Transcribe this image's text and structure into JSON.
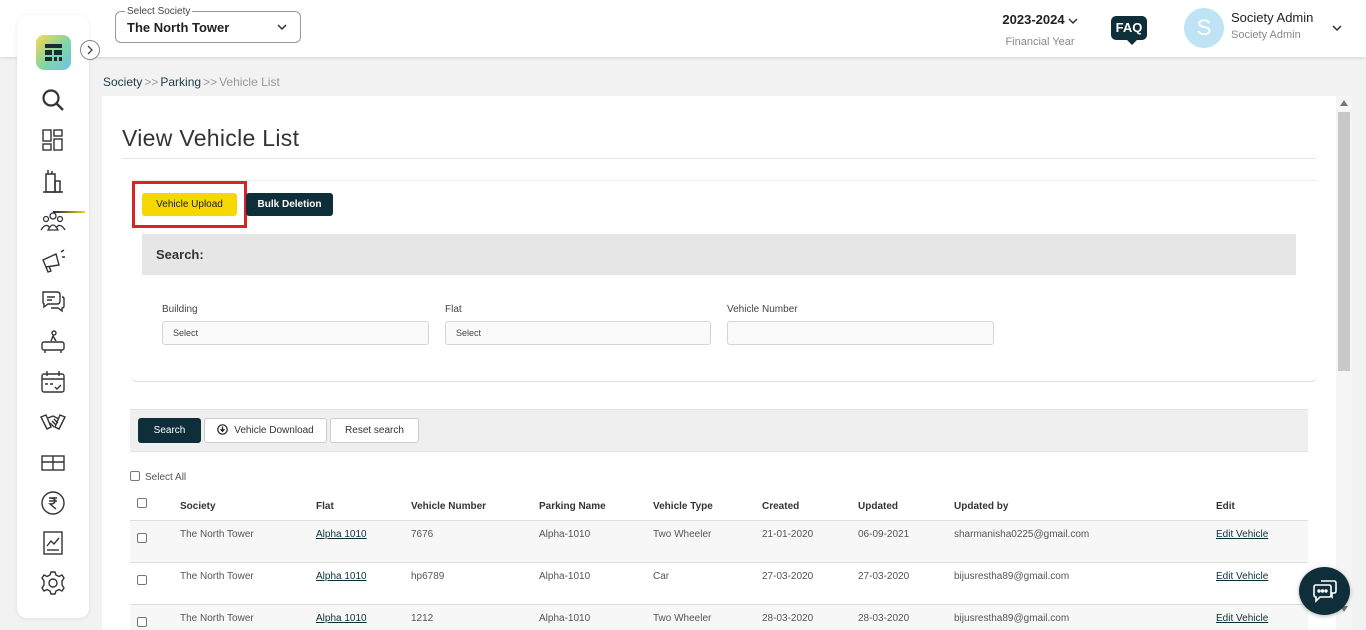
{
  "header": {
    "society_select": {
      "label": "Select Society",
      "value": "The North Tower"
    },
    "financial_year": {
      "value": "2023-2024",
      "label": "Financial Year"
    },
    "faq_label": "FAQ",
    "user": {
      "initial": "S",
      "name": "Society Admin",
      "role": "Society Admin"
    }
  },
  "sidebar": {
    "items": [
      {
        "icon": "search-icon"
      },
      {
        "icon": "dashboard-icon"
      },
      {
        "icon": "building-icon",
        "active": true
      },
      {
        "icon": "people-icon"
      },
      {
        "icon": "megaphone-icon"
      },
      {
        "icon": "chat-icon"
      },
      {
        "icon": "amenities-icon"
      },
      {
        "icon": "calendar-icon"
      },
      {
        "icon": "handshake-icon"
      },
      {
        "icon": "gift-icon"
      },
      {
        "icon": "rupee-icon"
      },
      {
        "icon": "report-icon"
      },
      {
        "icon": "settings-icon"
      }
    ]
  },
  "breadcrumb": {
    "items": [
      "Society",
      "Parking",
      "Vehicle List"
    ],
    "separator": ">>"
  },
  "page": {
    "title": "View Vehicle List",
    "buttons": {
      "upload": "Vehicle Upload",
      "bulk_delete": "Bulk Deletion"
    },
    "search": {
      "heading": "Search:",
      "building": {
        "label": "Building",
        "value": "Select"
      },
      "flat": {
        "label": "Flat",
        "value": "Select"
      },
      "vehicle_number": {
        "label": "Vehicle Number",
        "value": ""
      }
    },
    "actions": {
      "search": "Search",
      "download": "Vehicle Download",
      "reset": "Reset search"
    },
    "select_all": "Select All"
  },
  "table": {
    "columns": [
      "Society",
      "Flat",
      "Vehicle Number",
      "Parking Name",
      "Vehicle Type",
      "Created",
      "Updated",
      "Updated by",
      "Edit"
    ],
    "rows": [
      {
        "society": "The North Tower",
        "flat": "Alpha 1010",
        "vehicle_number": "7676",
        "parking_name": "Alpha-1010",
        "vehicle_type": "Two Wheeler",
        "created": "21-01-2020",
        "updated": "06-09-2021",
        "updated_by": "sharmanisha0225@gmail.com",
        "edit": "Edit Vehicle"
      },
      {
        "society": "The North Tower",
        "flat": "Alpha 1010",
        "vehicle_number": "hp6789",
        "parking_name": "Alpha-1010",
        "vehicle_type": "Car",
        "created": "27-03-2020",
        "updated": "27-03-2020",
        "updated_by": "bijusrestha89@gmail.com",
        "edit": "Edit Vehicle"
      },
      {
        "society": "The North Tower",
        "flat": "Alpha 1010",
        "vehicle_number": "1212",
        "parking_name": "Alpha-1010",
        "vehicle_type": "Two Wheeler",
        "created": "28-03-2020",
        "updated": "28-03-2020",
        "updated_by": "bijusrestha89@gmail.com",
        "edit": "Edit Vehicle"
      }
    ]
  },
  "colors": {
    "primary": "#0e2f3a",
    "accent": "#f5d800",
    "highlight": "#d9232a"
  }
}
